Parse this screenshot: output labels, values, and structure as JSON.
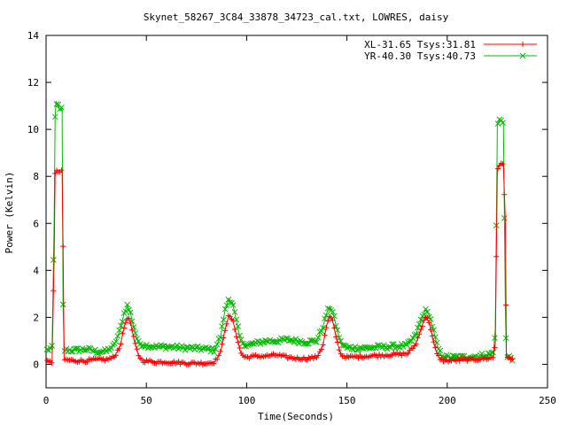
{
  "chart_data": {
    "type": "line",
    "title": "Skynet_58267_3C84_33878_34723_cal.txt, LOWRES, daisy",
    "xlabel": "Time(Seconds)",
    "ylabel": "Power (Kelvin)",
    "xlim": [
      0,
      250
    ],
    "ylim": [
      -1,
      14
    ],
    "xticks": [
      0,
      50,
      100,
      150,
      200,
      250
    ],
    "yticks": [
      0,
      2,
      4,
      6,
      8,
      10,
      12,
      14
    ],
    "grid": false,
    "legend_position": "top-right",
    "series": [
      {
        "name": "XL-31.65 Tsys:31.81",
        "color": "#ff0000",
        "marker": "plus",
        "points": [
          [
            0.5,
            0.1
          ],
          [
            3,
            0.1
          ],
          [
            4,
            4.5
          ],
          [
            4.5,
            8.1
          ],
          [
            5,
            8.2
          ],
          [
            7,
            8.2
          ],
          [
            8,
            8.2
          ],
          [
            8.5,
            5.0
          ],
          [
            9,
            0.2
          ],
          [
            15,
            0.15
          ],
          [
            20,
            0.15
          ],
          [
            25,
            0.2
          ],
          [
            30,
            0.2
          ],
          [
            34,
            0.3
          ],
          [
            37,
            0.8
          ],
          [
            39,
            1.6
          ],
          [
            40.5,
            2.0
          ],
          [
            42,
            1.8
          ],
          [
            44,
            1.0
          ],
          [
            46,
            0.4
          ],
          [
            48,
            0.15
          ],
          [
            55,
            0.1
          ],
          [
            60,
            0.1
          ],
          [
            70,
            0.05
          ],
          [
            80,
            0.05
          ],
          [
            84,
            0.1
          ],
          [
            87,
            0.5
          ],
          [
            89,
            1.4
          ],
          [
            91,
            2.05
          ],
          [
            93,
            1.9
          ],
          [
            95,
            1.2
          ],
          [
            97,
            0.5
          ],
          [
            99,
            0.3
          ],
          [
            105,
            0.35
          ],
          [
            110,
            0.35
          ],
          [
            115,
            0.4
          ],
          [
            120,
            0.3
          ],
          [
            125,
            0.25
          ],
          [
            130,
            0.25
          ],
          [
            135,
            0.3
          ],
          [
            138,
            0.8
          ],
          [
            140,
            1.7
          ],
          [
            141.5,
            2.05
          ],
          [
            143,
            1.8
          ],
          [
            145,
            1.0
          ],
          [
            147,
            0.4
          ],
          [
            150,
            0.3
          ],
          [
            160,
            0.35
          ],
          [
            170,
            0.4
          ],
          [
            180,
            0.45
          ],
          [
            184,
            0.8
          ],
          [
            187,
            1.5
          ],
          [
            189,
            2.05
          ],
          [
            191,
            1.8
          ],
          [
            193,
            1.0
          ],
          [
            195,
            0.4
          ],
          [
            197,
            0.2
          ],
          [
            200,
            0.15
          ],
          [
            210,
            0.2
          ],
          [
            220,
            0.25
          ],
          [
            223,
            0.3
          ],
          [
            224,
            0.9
          ],
          [
            225,
            8.3
          ],
          [
            226,
            8.5
          ],
          [
            228,
            8.5
          ],
          [
            229,
            6.0
          ],
          [
            229.5,
            0.3
          ],
          [
            232,
            0.2
          ],
          [
            233,
            0.2
          ]
        ]
      },
      {
        "name": "YR-40.30 Tsys:40.73",
        "color": "#00bb00",
        "marker": "x",
        "points": [
          [
            0.5,
            0.6
          ],
          [
            3,
            0.7
          ],
          [
            4,
            6.0
          ],
          [
            4.5,
            10.5
          ],
          [
            5,
            11.2
          ],
          [
            6,
            11.0
          ],
          [
            7,
            10.8
          ],
          [
            8,
            10.9
          ],
          [
            8.5,
            2.5
          ],
          [
            9,
            0.6
          ],
          [
            15,
            0.6
          ],
          [
            20,
            0.65
          ],
          [
            25,
            0.55
          ],
          [
            30,
            0.55
          ],
          [
            34,
            0.8
          ],
          [
            37,
            1.5
          ],
          [
            39,
            2.2
          ],
          [
            40.5,
            2.5
          ],
          [
            42,
            2.2
          ],
          [
            44,
            1.5
          ],
          [
            46,
            0.9
          ],
          [
            50,
            0.8
          ],
          [
            55,
            0.75
          ],
          [
            60,
            0.75
          ],
          [
            70,
            0.7
          ],
          [
            80,
            0.65
          ],
          [
            84,
            0.6
          ],
          [
            87,
            1.2
          ],
          [
            89,
            2.2
          ],
          [
            91,
            2.8
          ],
          [
            93,
            2.6
          ],
          [
            95,
            1.8
          ],
          [
            97,
            1.0
          ],
          [
            100,
            0.8
          ],
          [
            105,
            0.9
          ],
          [
            110,
            1.0
          ],
          [
            115,
            1.0
          ],
          [
            120,
            1.05
          ],
          [
            125,
            1.0
          ],
          [
            130,
            0.95
          ],
          [
            135,
            1.0
          ],
          [
            138,
            1.6
          ],
          [
            140,
            2.2
          ],
          [
            141.5,
            2.45
          ],
          [
            143,
            2.2
          ],
          [
            145,
            1.5
          ],
          [
            147,
            0.9
          ],
          [
            150,
            0.7
          ],
          [
            160,
            0.7
          ],
          [
            170,
            0.75
          ],
          [
            180,
            0.8
          ],
          [
            184,
            1.2
          ],
          [
            187,
            1.9
          ],
          [
            189,
            2.3
          ],
          [
            191,
            2.1
          ],
          [
            193,
            1.5
          ],
          [
            195,
            0.8
          ],
          [
            197,
            0.4
          ],
          [
            200,
            0.3
          ],
          [
            210,
            0.3
          ],
          [
            215,
            0.35
          ],
          [
            220,
            0.4
          ],
          [
            223,
            0.5
          ],
          [
            224,
            1.5
          ],
          [
            225,
            10.2
          ],
          [
            226,
            10.4
          ],
          [
            228,
            10.3
          ],
          [
            229,
            2.3
          ],
          [
            229.5,
            0.3
          ],
          [
            232,
            0.3
          ],
          [
            233,
            0.2
          ]
        ]
      }
    ]
  }
}
